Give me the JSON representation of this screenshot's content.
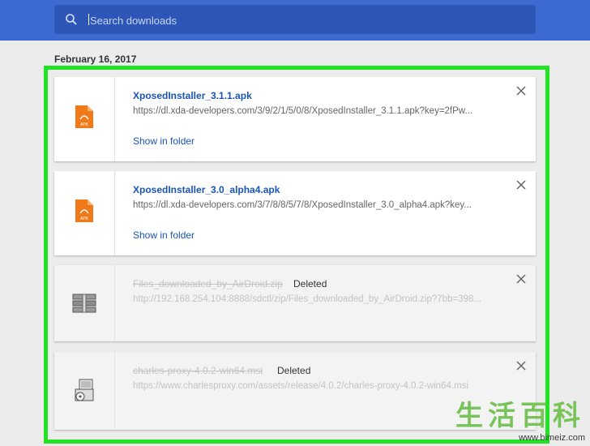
{
  "search": {
    "placeholder": "Search downloads"
  },
  "date_header": "February 16, 2017",
  "downloads": [
    {
      "name": "XposedInstaller_3.1.1.apk",
      "url": "https://dl.xda-developers.com/3/9/2/1/5/0/8/XposedInstaller_3.1.1.apk?key=2fPw...",
      "action": "Show in folder",
      "status": "",
      "icon": "apk-file-icon",
      "icon_label": "APK"
    },
    {
      "name": "XposedInstaller_3.0_alpha4.apk",
      "url": "https://dl.xda-developers.com/3/7/8/8/5/7/8/XposedInstaller_3.0_alpha4.apk?key...",
      "action": "Show in folder",
      "status": "",
      "icon": "apk-file-icon",
      "icon_label": "APK"
    },
    {
      "name": "Files_downloaded_by_AirDroid.zip",
      "url": "http://192.168.254.104:8888/sdctl/zip/Files_downloaded_by_AirDroid.zip?7bb=398...",
      "action": "",
      "status": "Deleted",
      "icon": "zip-archive-icon"
    },
    {
      "name": "charles-proxy-4.0.2-win64.msi",
      "url": "https://www.charlesproxy.com/assets/release/4.0.2/charles-proxy-4.0.2-win64.msi",
      "action": "",
      "status": "Deleted",
      "icon": "msi-installer-icon"
    }
  ],
  "watermark": {
    "text": "生活百科",
    "site": "www.bimeiz.com"
  },
  "colors": {
    "topbar": "#3d6ad0",
    "search_box": "#2d56b8",
    "highlight": "#22e224",
    "link": "#1a55b5",
    "apk_orange": "#f07a1a"
  }
}
